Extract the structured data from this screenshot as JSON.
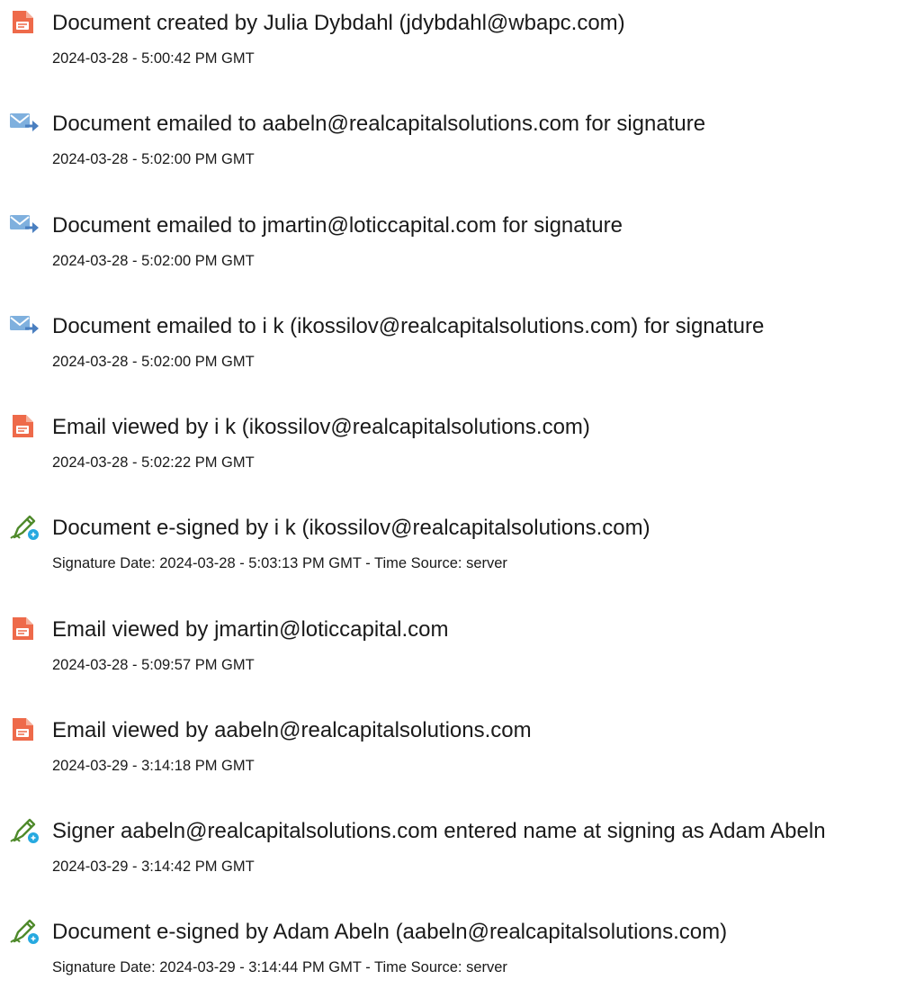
{
  "events": [
    {
      "icon": "document-icon",
      "title": "Document created by Julia Dybdahl (jdybdahl@wbapc.com)",
      "sub": "2024-03-28 - 5:00:42 PM GMT"
    },
    {
      "icon": "email-sent-icon",
      "title": "Document emailed to aabeln@realcapitalsolutions.com for signature",
      "sub": "2024-03-28 - 5:02:00 PM GMT"
    },
    {
      "icon": "email-sent-icon",
      "title": "Document emailed to jmartin@loticcapital.com for signature",
      "sub": "2024-03-28 - 5:02:00 PM GMT"
    },
    {
      "icon": "email-sent-icon",
      "title": "Document emailed to i k (ikossilov@realcapitalsolutions.com) for signature",
      "sub": "2024-03-28 - 5:02:00 PM GMT"
    },
    {
      "icon": "document-icon",
      "title": "Email viewed by i k (ikossilov@realcapitalsolutions.com)",
      "sub": "2024-03-28 - 5:02:22 PM GMT"
    },
    {
      "icon": "esign-pen-icon",
      "title": "Document e-signed by i k (ikossilov@realcapitalsolutions.com)",
      "sub": "Signature Date: 2024-03-28 - 5:03:13 PM GMT - Time Source: server"
    },
    {
      "icon": "document-icon",
      "title": "Email viewed by jmartin@loticcapital.com",
      "sub": "2024-03-28 - 5:09:57 PM GMT"
    },
    {
      "icon": "document-icon",
      "title": "Email viewed by aabeln@realcapitalsolutions.com",
      "sub": "2024-03-29 - 3:14:18 PM GMT"
    },
    {
      "icon": "esign-pen-icon",
      "title": "Signer aabeln@realcapitalsolutions.com entered name at signing as Adam Abeln",
      "sub": "2024-03-29 - 3:14:42 PM GMT"
    },
    {
      "icon": "esign-pen-icon",
      "title": "Document e-signed by Adam Abeln (aabeln@realcapitalsolutions.com)",
      "sub": "Signature Date: 2024-03-29 - 3:14:44 PM GMT - Time Source: server"
    }
  ],
  "colors": {
    "document_icon": "#ee6a4a",
    "email_icon": "#7fb0de",
    "email_arrow": "#4a7fc0",
    "pen_icon": "#4f8a2b",
    "pen_badge": "#26a9e0"
  }
}
